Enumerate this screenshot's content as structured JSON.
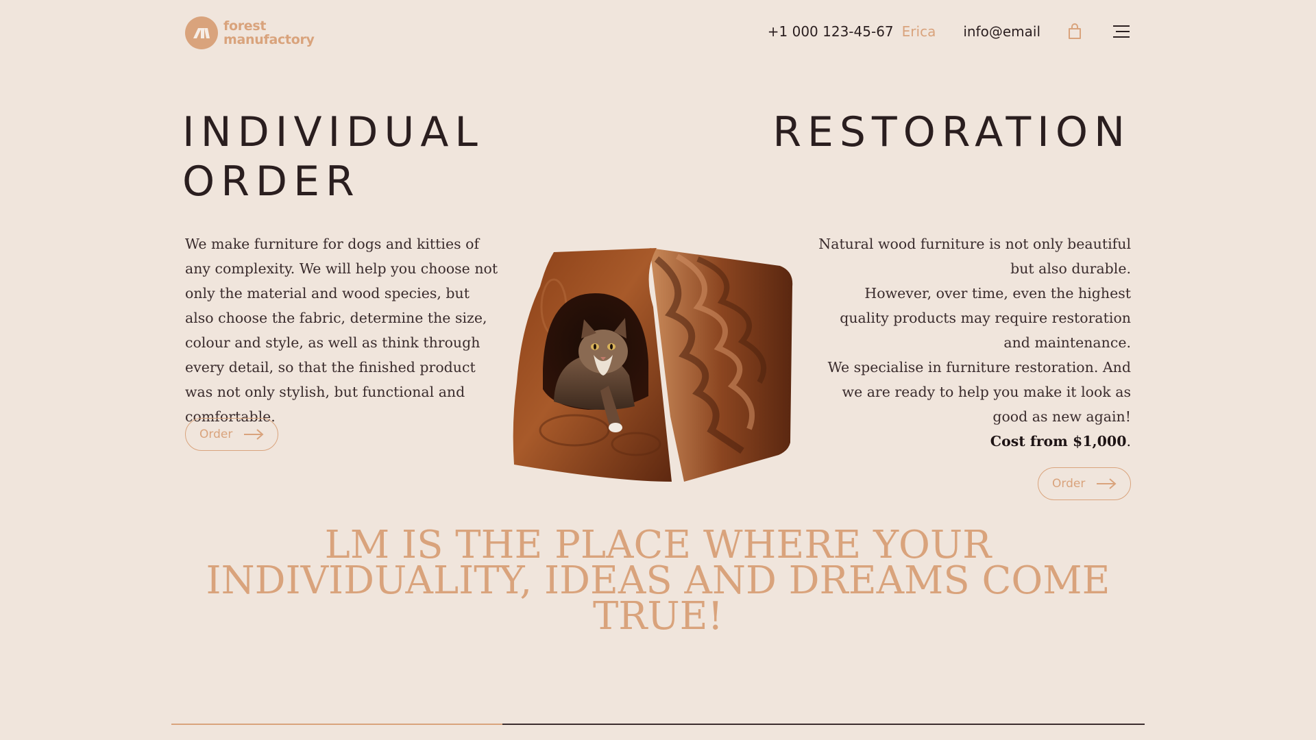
{
  "header": {
    "logo_line1": "forest",
    "logo_line2": "manufactory",
    "phone": "+1 000 123-45-67",
    "user_name": "Erica",
    "email": "info@email",
    "cart_icon": "shopping-bag-icon",
    "menu_icon": "hamburger-menu-icon"
  },
  "individual": {
    "title_line1": "INDIVIDUAL",
    "title_line2": "ORDER",
    "text": "We make furniture for dogs and kitties of any complexity. We will help you choose not only the material and wood species, but also choose the fabric, determine the size, colour and style, as well as think through every detail, so that the finished product was not only stylish, but functional and comfortable.",
    "button_label": "Order"
  },
  "restoration": {
    "title": "RESTORATION",
    "text_1": "Natural wood furniture is not only beautiful but also durable.",
    "text_2": "However, over time, even the highest quality products may require restoration and maintenance.",
    "text_3": "We specialise in furniture restoration. And we are ready to help you make it look as good as new again!",
    "cost_label": "Cost from $1,000",
    "cost_suffix": ".",
    "button_label": "Order"
  },
  "tagline": "LM IS THE PLACE WHERE YOUR INDIVIDUALITY, IDEAS AND DREAMS COME TRUE!",
  "slider": {
    "progress": 0.34
  },
  "colors": {
    "background": "#f0e5dc",
    "accent": "#d9a37c",
    "text": "#2a1e1f"
  }
}
